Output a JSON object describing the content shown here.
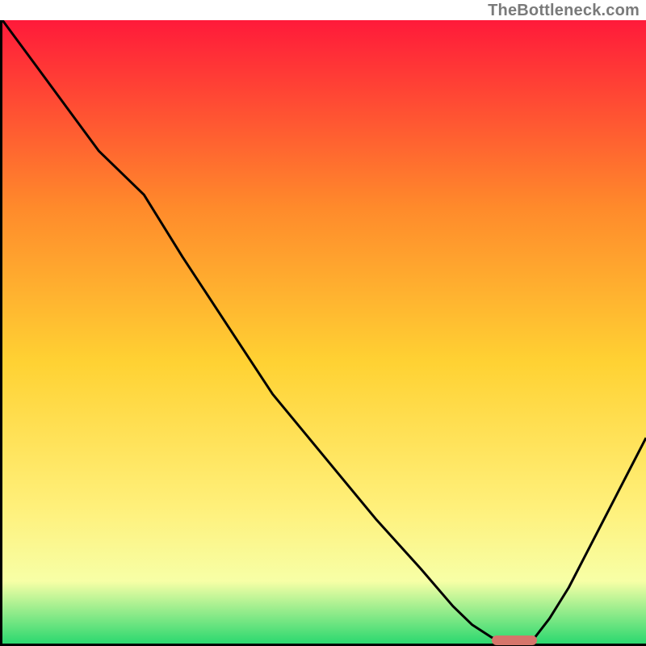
{
  "watermark": "TheBottleneck.com",
  "chart_data": {
    "type": "line",
    "title": "",
    "xlabel": "",
    "ylabel": "",
    "xlim": [
      0,
      100
    ],
    "ylim": [
      0,
      100
    ],
    "grid": false,
    "gradient_colors": {
      "top": "#ff1a3a",
      "mid_upper": "#ff8a2b",
      "mid": "#ffd233",
      "mid_lower": "#fff07a",
      "lower": "#f7ffa6",
      "bottom": "#2bd86f"
    },
    "series": [
      {
        "name": "curve",
        "color": "#000000",
        "x": [
          0,
          5,
          10,
          15,
          22,
          28,
          35,
          42,
          50,
          58,
          65,
          70,
          73,
          76,
          79,
          82,
          85,
          88,
          91,
          94,
          97,
          100
        ],
        "y": [
          100,
          93,
          86,
          79,
          72,
          62,
          51,
          40,
          30,
          20,
          12,
          6,
          3,
          1,
          0,
          0,
          4,
          9,
          15,
          21,
          27,
          33
        ]
      }
    ],
    "marker": {
      "name": "optimal-range",
      "color": "#d6756b",
      "x_start": 76,
      "x_end": 83,
      "y": 0.5
    }
  }
}
